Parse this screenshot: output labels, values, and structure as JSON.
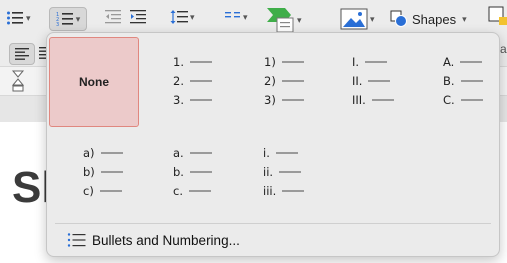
{
  "toolbar": {
    "shapes_label": "Shapes",
    "arrange_label": "rra"
  },
  "document": {
    "heading_fragment": "Sl"
  },
  "numbering_gallery": {
    "none_label": "None",
    "styles": [
      {
        "id": "numeric-dot",
        "items": [
          "1.",
          "2.",
          "3."
        ]
      },
      {
        "id": "numeric-paren",
        "items": [
          "1)",
          "2)",
          "3)"
        ]
      },
      {
        "id": "roman-upper",
        "items": [
          "I.",
          "II.",
          "III."
        ]
      },
      {
        "id": "alpha-upper",
        "items": [
          "A.",
          "B.",
          "C."
        ]
      },
      {
        "id": "alpha-lower-paren",
        "items": [
          "a)",
          "b)",
          "c)"
        ]
      },
      {
        "id": "alpha-lower-dot",
        "items": [
          "a.",
          "b.",
          "c."
        ]
      },
      {
        "id": "roman-lower",
        "items": [
          "i.",
          "ii.",
          "iii."
        ]
      }
    ],
    "footer_label": "Bullets and Numbering..."
  }
}
